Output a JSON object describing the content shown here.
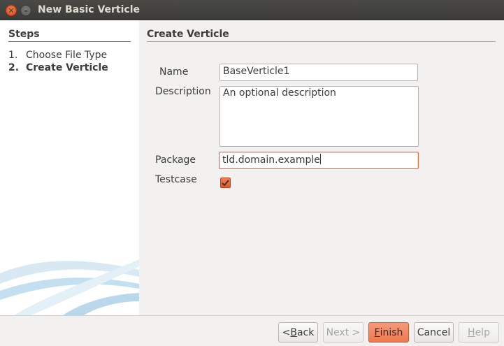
{
  "window": {
    "title": "New Basic Verticle"
  },
  "steps": {
    "heading": "Steps",
    "items": [
      {
        "number": "1.",
        "label": "Choose File Type"
      },
      {
        "number": "2.",
        "label": "Create Verticle"
      }
    ]
  },
  "form": {
    "heading": "Create Verticle",
    "name_label": "Name",
    "name_value": "BaseVerticle1",
    "description_label": "Description",
    "description_value": "An optional description",
    "package_label": "Package",
    "package_value": "tld.domain.example",
    "testcase_label": "Testcase",
    "testcase_checked": true
  },
  "buttons": {
    "back": {
      "prefix": "<",
      "mnemonic": "B",
      "rest": "ack"
    },
    "next": {
      "label": "Next >"
    },
    "finish": {
      "mnemonic": "F",
      "rest": "inish"
    },
    "cancel": {
      "label": "Cancel"
    },
    "help": {
      "mnemonic": "H",
      "rest": "elp"
    }
  },
  "colors": {
    "accent": "#ee7a50",
    "titlebar": "#3c3b37"
  }
}
